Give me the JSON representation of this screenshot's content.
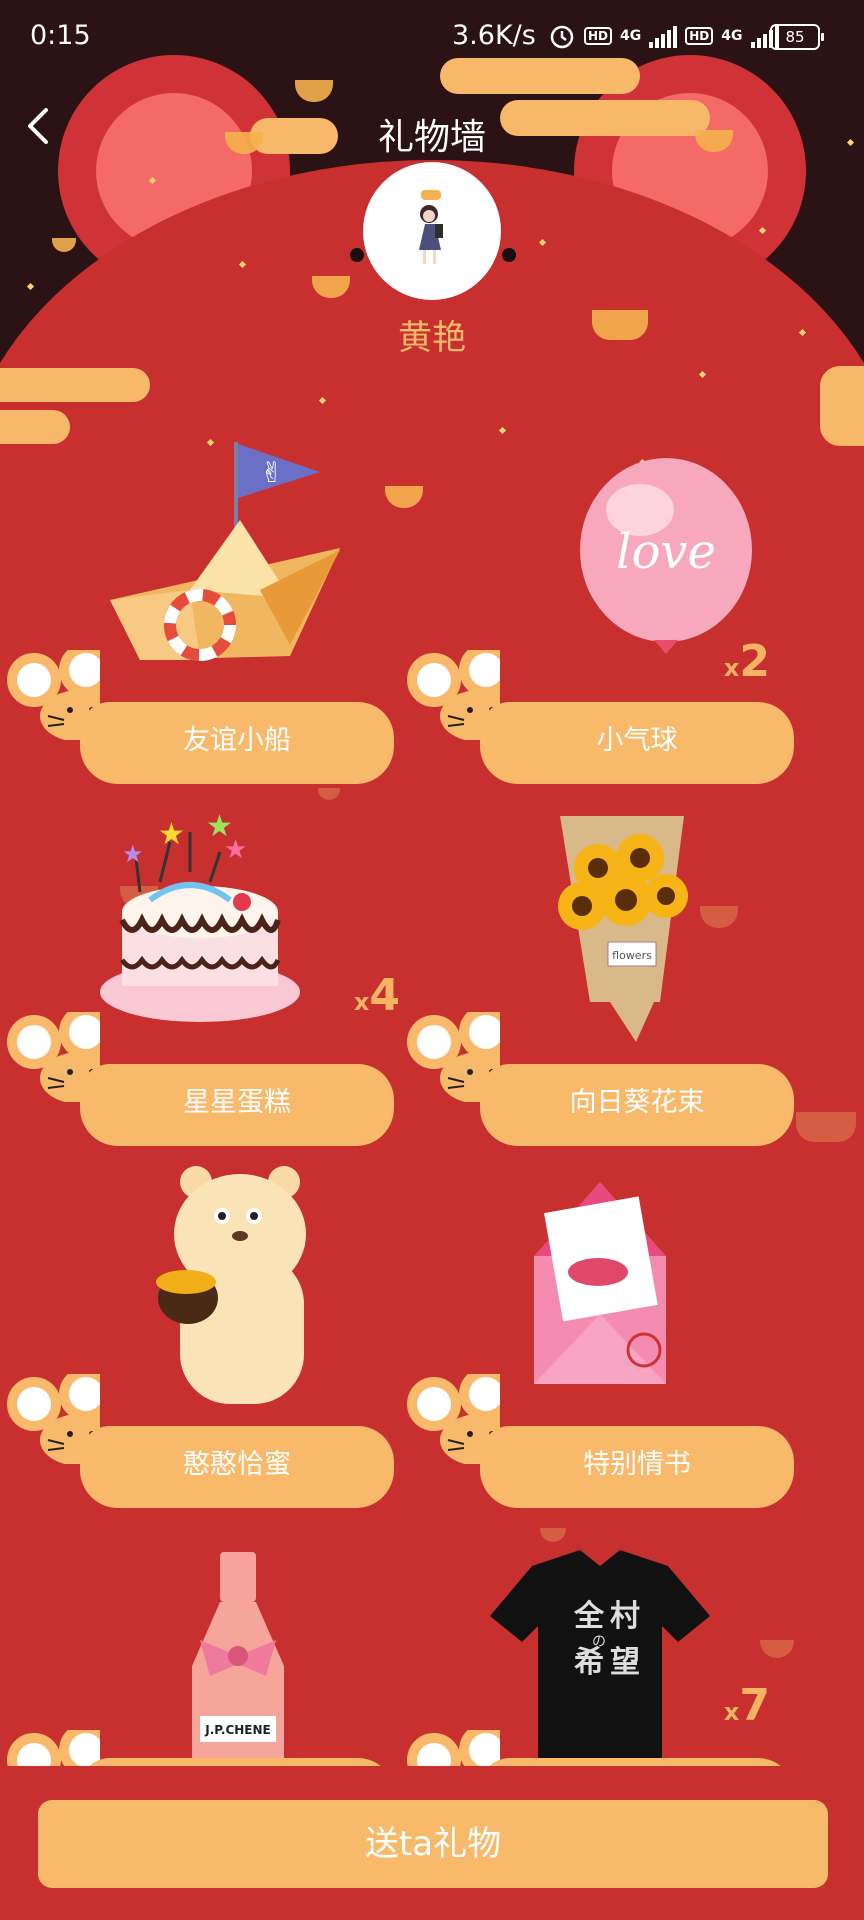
{
  "status_bar": {
    "time": "0:15",
    "network_speed": "3.6K/s",
    "battery": "85",
    "signal_labels": [
      "HD",
      "4G",
      "HD",
      "4G"
    ]
  },
  "header": {
    "title": "礼物墙",
    "back_icon": "chevron-left-icon"
  },
  "profile": {
    "name": "黄艳"
  },
  "gifts": [
    {
      "label": "友谊小船",
      "quantity": null,
      "art": "paper-boat"
    },
    {
      "label": "小气球",
      "quantity": "2",
      "art": "love-balloon",
      "balloon_text": "love"
    },
    {
      "label": "星星蛋糕",
      "quantity": "4",
      "art": "star-cake"
    },
    {
      "label": "向日葵花束",
      "quantity": null,
      "art": "sunflower-bouquet",
      "tag_text": "flowers"
    },
    {
      "label": "憨憨恰蜜",
      "quantity": null,
      "art": "honey-bear"
    },
    {
      "label": "特别情书",
      "quantity": null,
      "art": "love-letter"
    },
    {
      "label": "",
      "quantity": null,
      "art": "rose-wine",
      "bottle_text": "J.P.CHENE"
    },
    {
      "label": "",
      "quantity": "7",
      "art": "black-tshirt",
      "shirt_text": [
        "全",
        "村",
        "の",
        "希",
        "望"
      ]
    }
  ],
  "qty_prefix": "x",
  "send_button": {
    "label": "送ta礼物"
  },
  "colors": {
    "background_red": "#c8302f",
    "dark_top": "#2b1214",
    "accent_orange": "#f8b96b",
    "username": "#f6b96a"
  }
}
